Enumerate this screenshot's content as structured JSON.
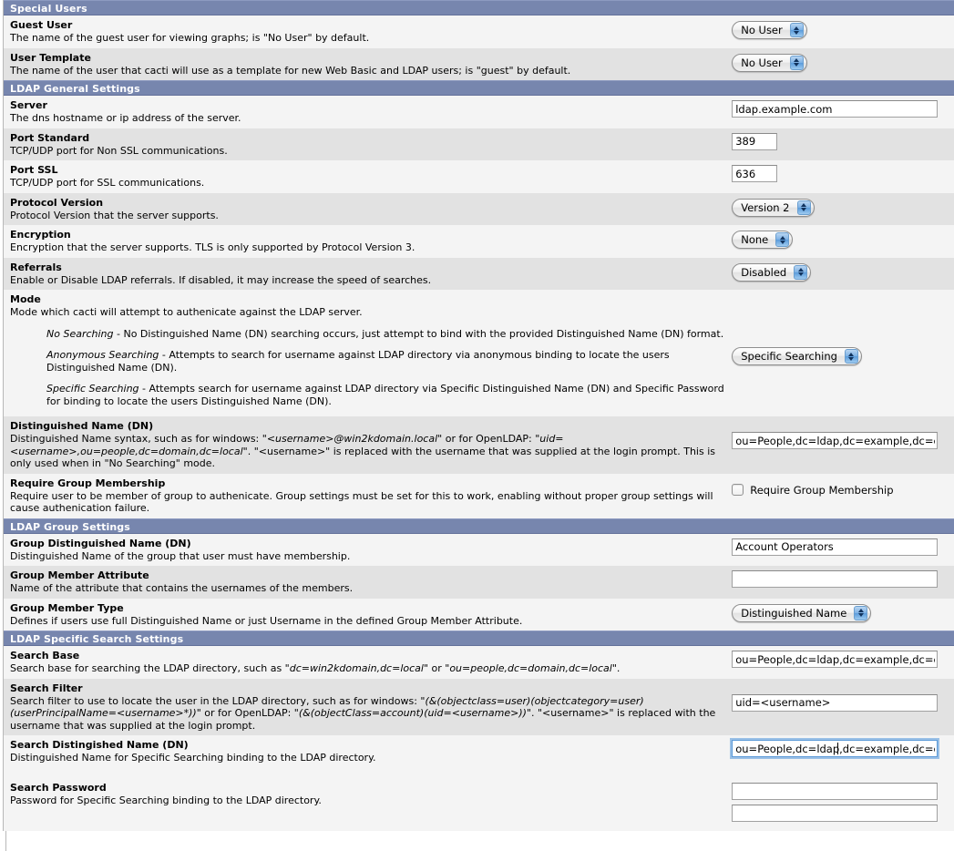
{
  "sections": [
    {
      "id": "special-users",
      "title": "Special Users",
      "rows": [
        {
          "name": "guest-user",
          "title": "Guest User",
          "desc": "The name of the guest user for viewing graphs; is \"No User\" by default.",
          "control": "select",
          "value": "No User",
          "width": "w-user"
        },
        {
          "name": "user-template",
          "title": "User Template",
          "desc": "The name of the user that cacti will use as a template for new Web Basic and LDAP users; is \"guest\" by default.",
          "control": "select",
          "value": "No User",
          "width": "w-user"
        }
      ]
    },
    {
      "id": "ldap-general-settings",
      "title": "LDAP General Settings",
      "rows": [
        {
          "name": "server",
          "title": "Server",
          "desc": "The dns hostname or ip address of the server.",
          "control": "text",
          "value": "ldap.example.com",
          "width": "wide"
        },
        {
          "name": "port-standard",
          "title": "Port Standard",
          "desc": "TCP/UDP port for Non SSL communications.",
          "control": "text",
          "value": "389",
          "width": "narrow"
        },
        {
          "name": "port-ssl",
          "title": "Port SSL",
          "desc": "TCP/UDP port for SSL communications.",
          "control": "text",
          "value": "636",
          "width": "narrow"
        },
        {
          "name": "protocol-version",
          "title": "Protocol Version",
          "desc": "Protocol Version that the server supports.",
          "control": "select",
          "value": "Version 2",
          "width": "w-ver"
        },
        {
          "name": "encryption",
          "title": "Encryption",
          "desc": "Encryption that the server supports. TLS is only supported by Protocol Version 3.",
          "control": "select",
          "value": "None",
          "width": "w-none"
        },
        {
          "name": "referrals",
          "title": "Referrals",
          "desc": "Enable or Disable LDAP referrals. If disabled, it may increase the speed of searches.",
          "control": "select",
          "value": "Disabled",
          "width": "w-dis"
        }
      ]
    }
  ],
  "mode_row": {
    "name": "mode",
    "title": "Mode",
    "desc": "Mode which cacti will attempt to authenicate against the LDAP server.",
    "paragraphs": [
      {
        "term": "No Searching",
        "body": " - No Distinguished Name (DN) searching occurs, just attempt to bind with the provided Distinguished Name (DN) format."
      },
      {
        "term": "Anonymous Searching",
        "body": " - Attempts to search for username against LDAP directory via anonymous binding to locate the users Distinguished Name (DN)."
      },
      {
        "term": "Specific Searching",
        "body": " - Attempts search for username against LDAP directory via Specific Distinguished Name (DN) and Specific Password for binding to locate the users Distinguished Name (DN)."
      }
    ],
    "value": "Specific Searching"
  },
  "dn_row": {
    "name": "distinguished-name",
    "title": "Distinguished Name (DN)",
    "desc_part1": "Distinguished Name syntax, such as for windows: \"",
    "desc_em1": "<username>@win2kdomain.local",
    "desc_part2": "\" or for OpenLDAP: \"",
    "desc_em2": "uid=<username>,ou=people,dc=domain,dc=local",
    "desc_part3": "\". \"<username>\" is replaced with the username that was supplied at the login prompt. This is only used when in \"No Searching\" mode.",
    "value": "ou=People,dc=ldap,dc=example,dc=cor"
  },
  "group_membership_row": {
    "name": "require-group-membership",
    "title": "Require Group Membership",
    "desc": "Require user to be member of group to authenicate. Group settings must be set for this to work, enabling without proper group settings will cause authenication failure.",
    "checkbox_label": "Require Group Membership",
    "checked": false
  },
  "group_section": {
    "id": "ldap-group-settings",
    "title": "LDAP Group Settings",
    "rows": [
      {
        "name": "group-distinguished-name",
        "title": "Group Distinguished Name (DN)",
        "desc": "Distinguished Name of the group that user must have membership.",
        "control": "text",
        "value": "Account Operators",
        "width": "wide"
      },
      {
        "name": "group-member-attribute",
        "title": "Group Member Attribute",
        "desc": "Name of the attribute that contains the usernames of the members.",
        "control": "text",
        "value": "",
        "width": "wide"
      },
      {
        "name": "group-member-type",
        "title": "Group Member Type",
        "desc": "Defines if users use full Distinguished Name or just Username in the defined Group Member Attribute.",
        "control": "select",
        "value": "Distinguished Name",
        "width": "w-dn"
      }
    ]
  },
  "search_section": {
    "id": "ldap-specific-search-settings",
    "title": "LDAP Specific Search Settings"
  },
  "search_base_row": {
    "name": "search-base",
    "title": "Search Base",
    "desc_part1": "Search base for searching the LDAP directory, such as \"",
    "desc_em1": "dc=win2kdomain,dc=local",
    "desc_part2": "\" or \"",
    "desc_em2": "ou=people,dc=domain,dc=local",
    "desc_part3": "\".",
    "value": "ou=People,dc=ldap,dc=example,dc=cor"
  },
  "search_filter_row": {
    "name": "search-filter",
    "title": "Search Filter",
    "desc_part1": "Search filter to use to locate the user in the LDAP directory, such as for windows: \"",
    "desc_em1": "(&(objectclass=user)(objectcategory=user)(userPrincipalName=<username>*))",
    "desc_part2": "\" or for OpenLDAP: \"",
    "desc_em2": "(&(objectClass=account)(uid=<username>))",
    "desc_part3": "\". \"<username>\" is replaced with the username that was supplied at the login prompt.",
    "value": "uid=<username>"
  },
  "search_dn_row": {
    "name": "search-distinguished-name",
    "title": "Search Distingished Name (DN)",
    "desc": "Distinguished Name for Specific Searching binding to the LDAP directory.",
    "value": "ou=People,dc=ldap,dc=example,dc=cor",
    "focused": true
  },
  "search_password_row": {
    "name": "search-password",
    "title": "Search Password",
    "desc": "Password for Specific Searching binding to the LDAP directory.",
    "value": "",
    "value2": ""
  },
  "colors": {
    "section_bar": "#7786ae",
    "row_light": "#f4f4f4",
    "row_dark": "#e2e2e2",
    "focus_ring": "#5b9ad8"
  }
}
